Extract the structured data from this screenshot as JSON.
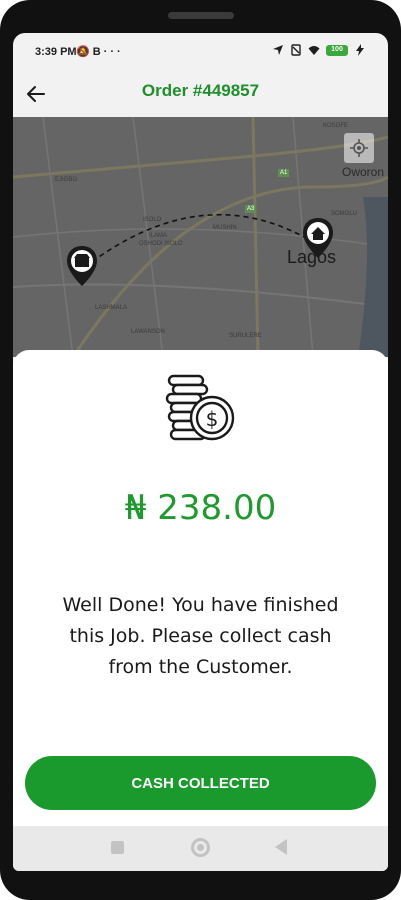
{
  "status_bar": {
    "time": "3:39 PM",
    "left_icons": [
      "mute-icon",
      "b-icon",
      "signal-dots-icon",
      "more-icon"
    ],
    "right_icons": [
      "location-icon",
      "sim-off-icon",
      "wifi-icon",
      "battery-icon"
    ],
    "battery": "100"
  },
  "header": {
    "title": "Order #449857"
  },
  "map": {
    "city": "Lagos",
    "place_labels": [
      "KOSOFE",
      "Oworon",
      "EJIGBO",
      "ISOLO",
      "MUSHIN",
      "ILAMA",
      "SOMOLU",
      "LASHMALA",
      "LAWANSON",
      "SURULERE",
      "OSHODI ISOLO"
    ],
    "road_labels": [
      "A1",
      "A3"
    ]
  },
  "sheet": {
    "amount": "₦ 238.00",
    "message": "Well Done! You have finished this Job. Please collect cash from the Customer.",
    "button_label": "CASH COLLECTED"
  },
  "colors": {
    "accent": "#1a9a2c",
    "title": "#1f8f2c"
  }
}
